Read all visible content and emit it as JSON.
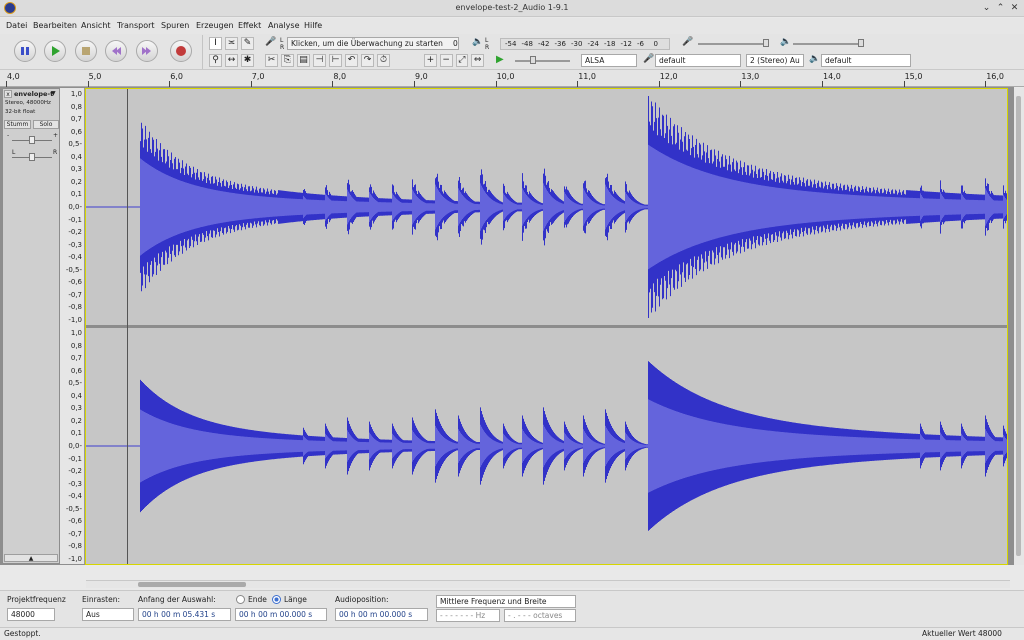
{
  "window": {
    "title": "envelope-test-2_Audio 1-9.1",
    "controls": [
      "⌄",
      "⌃",
      "◇",
      "✕"
    ]
  },
  "menu": [
    "Datei",
    "Bearbeiten",
    "Ansicht",
    "Transport",
    "Spuren",
    "Erzeugen",
    "Effekt",
    "Analyse",
    "Hilfe"
  ],
  "transport": {
    "pause": "pause",
    "play": "play",
    "stop": "stop",
    "skip_start": "skip-to-start",
    "skip_end": "skip-to-end",
    "record": "record"
  },
  "meter": {
    "record_prompt": "Klicken, um die Überwachung zu starten",
    "record_marker": "0",
    "play_scale": [
      "-54",
      "-48",
      "-42",
      "-36",
      "-30",
      "-24",
      "-18",
      "-12",
      "-6",
      "0"
    ],
    "ch_l": "L",
    "ch_r": "R"
  },
  "device": {
    "host": "ALSA",
    "recording_device": "default",
    "channels": "2 (Stereo) Au",
    "playback_device": "default"
  },
  "ruler": {
    "ticks": [
      "4,0",
      "5,0",
      "6,0",
      "7,0",
      "8,0",
      "9,0",
      "10,0",
      "11,0",
      "12,0",
      "13,0",
      "14,0",
      "15,0",
      "16,0"
    ]
  },
  "track": {
    "name": "envelope-t",
    "info1": "Stereo, 48000Hz",
    "info2": "32-bit float",
    "mute": "Stumm",
    "solo": "Solo",
    "gain_min": "-",
    "gain_max": "+",
    "pan_l": "L",
    "pan_r": "R",
    "close": "x",
    "menu_arrow": "▼",
    "collapse": "▲",
    "scale": [
      "1,0",
      "0,8",
      "0,7",
      "0,6",
      "0,5-",
      "0,4",
      "0,3",
      "0,2",
      "0,1",
      "0,0-",
      "-0,1",
      "-0,2",
      "-0,3",
      "-0,4",
      "-0,5-",
      "-0,6",
      "-0,7",
      "-0,8",
      "-1,0"
    ]
  },
  "colors": {
    "wave": "#3232c8",
    "wave_rms": "#6464dc",
    "track_bg": "#c6c6c6",
    "selection_bg": "#b5b5b5"
  },
  "selection": {
    "project_rate_label": "Projektfrequenz",
    "project_rate": "48000",
    "snap_label": "Einrasten:",
    "snap_value": "Aus",
    "start_label": "Anfang der Auswahl:",
    "start_value": "00 h 00 m 05.431 s",
    "end_label": "Ende",
    "length_label": "Länge",
    "length_value": "00 h 00 m 00.000 s",
    "audio_pos_label": "Audioposition:",
    "audio_pos_value": "00 h 00 m 00.000 s",
    "spectral_label": "Mittlere Frequenz und Breite",
    "freq_value": "- - - - - - - Hz",
    "octaves_value": "- . - - - octaves"
  },
  "status": {
    "left": "Gestoppt.",
    "right": "Aktueller Wert 48000"
  }
}
